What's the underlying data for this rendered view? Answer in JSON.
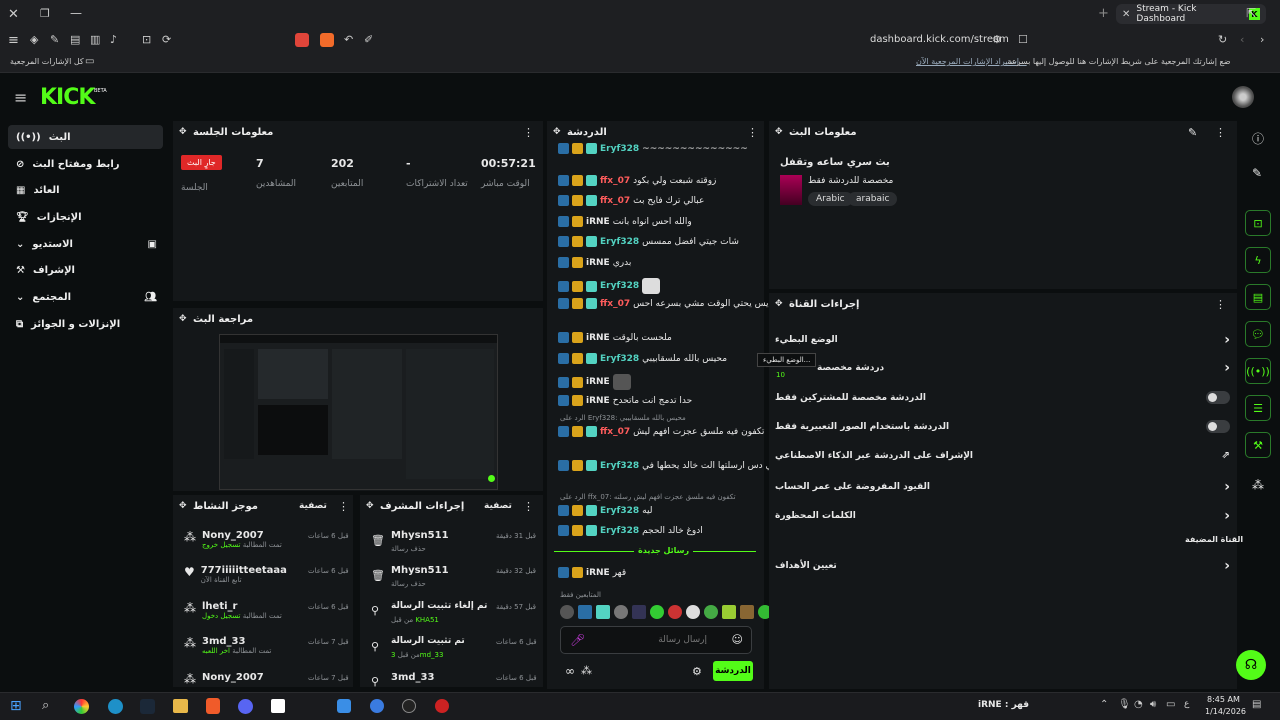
{
  "browser": {
    "tab_title": "Stream - Kick Dashboard",
    "url": "dashboard.kick.com/stream",
    "bookmark_hint": "ضع إشارتك المرجعية على شريط الإشارات هنا للوصول إليها بسرعة.",
    "bookmark_link": "إستيراد الإشارات المرجعية الآن...",
    "all_bookmarks": "كل الإشارات المرجعية"
  },
  "brand": {
    "logo": "KICK",
    "beta": "BETA",
    "accent": "#53fc18"
  },
  "nav": [
    {
      "label": "البث",
      "icon": "live-icon"
    },
    {
      "label": "رابط ومفتاح البث",
      "icon": "link-icon"
    },
    {
      "label": "العائد",
      "icon": "revenue-icon"
    },
    {
      "label": "الإنجازات",
      "icon": "trophy-icon"
    },
    {
      "label": "الاستديو",
      "icon": "studio-icon"
    },
    {
      "label": "الإشراف",
      "icon": "moderation-icon"
    },
    {
      "label": "المجتمع",
      "icon": "community-icon"
    },
    {
      "label": "الإنزالات و الجوائز",
      "icon": "drops-icon"
    }
  ],
  "session": {
    "title": "معلومات الجلسة",
    "live_badge": "جارٍ البث",
    "session_label": "الجلسة",
    "stats": [
      {
        "value": "7",
        "label": "المشاهدين"
      },
      {
        "value": "202",
        "label": "المتابعين"
      },
      {
        "value": "-",
        "label": "تعداد الاشتراكات"
      },
      {
        "value": "00:57:21",
        "label": "الوقت مباشر"
      }
    ]
  },
  "preview": {
    "title": "مراجعة البث"
  },
  "feed": {
    "title": "موجز النشاط",
    "filter": "تصفية",
    "items": [
      {
        "user": "Nony_2007",
        "sub": "تمت المطالبة",
        "action": "تسجيل خروج",
        "time": "قبل 6 ساعات"
      },
      {
        "user": "777iiiiitteetaaa",
        "sub": "تابع القناة الآن",
        "action": "",
        "time": "قبل 6 ساعات"
      },
      {
        "user": "lheti_r",
        "sub": "تمت المطالبة",
        "action": "تسجيل دخول",
        "time": "قبل 6 ساعات"
      },
      {
        "user": "3md_33",
        "sub": "تمت المطالبة",
        "action": "اخر اللعبه",
        "time": "قبل 7 ساعات"
      },
      {
        "user": "Nony_2007",
        "sub": "",
        "action": "",
        "time": "قبل 7 ساعات"
      }
    ]
  },
  "modlog": {
    "title": "إجراءات المشرف",
    "filter": "تصفية",
    "items": [
      {
        "user": "Mhysn511",
        "sub": "حذف رسالة",
        "time": "قبل 31 دقيقة"
      },
      {
        "user": "Mhysn511",
        "sub": "حذف رسالة",
        "time": "قبل 32 دقيقة"
      },
      {
        "user": "تم إلغاء تثبيت الرسالة",
        "sub": "من قبل",
        "by": "KHA51",
        "time": "قبل 57 دقيقة"
      },
      {
        "user": "تم تثبيت الرسالة",
        "sub": "من قبل",
        "by": "3md_33",
        "time": "قبل 6 ساعات"
      },
      {
        "user": "3md_33",
        "sub": "",
        "time": "قبل 6 ساعات"
      }
    ]
  },
  "chat": {
    "title": "الدردشة",
    "new_messages": "رسائل جديدة",
    "followers_only": "المتابعين فقط",
    "placeholder": "إرسال رسالة",
    "send": "الدردشة",
    "messages": [
      {
        "user": "Eryf328",
        "text": "~~~~~~~~~~~~~~",
        "color": "#53d3c2"
      },
      {
        "user": "ffx_07",
        "text": "زوقته شبعت ولي بكود",
        "color": "#ff5c5c"
      },
      {
        "user": "ffx_07",
        "text": "عبالي ترك فايح بث",
        "color": "#ff5c5c"
      },
      {
        "user": "iRNE",
        "text": "والله احس انواه بانت",
        "color": "#ffffff"
      },
      {
        "user": "Eryf328",
        "text": "شات جيتي افضل ممسس",
        "color": "#53d3c2"
      },
      {
        "user": "iRNE",
        "text": "بدري",
        "color": "#ffffff"
      },
      {
        "user": "Eryf328",
        "text": "",
        "color": "#53d3c2"
      },
      {
        "user": "ffx_07",
        "text": "يس يحتي الوقت مشي بسرعه احس",
        "color": "#ff5c5c"
      },
      {
        "user": "iRNE",
        "text": "ملحست بالوقت",
        "color": "#ffffff"
      },
      {
        "user": "Eryf328",
        "text": "محيس بالله ملسقابيبي",
        "color": "#53d3c2"
      },
      {
        "user": "iRNE",
        "text": "",
        "color": "#ffffff"
      },
      {
        "user": "iRNE",
        "text": "حدا تدمج انت ماتحدح",
        "color": "#ffffff"
      },
      {
        "user": "ffx_07",
        "text": "تكفون فيه ملسق عجزت افهم ليش",
        "color": "#ff5c5c"
      },
      {
        "user": "Eryf328",
        "text": "في دس ارسلتها الت خالد يحطها في",
        "color": "#53d3c2"
      },
      {
        "user": "Eryf328",
        "text": "ليه",
        "color": "#53d3c2"
      },
      {
        "user": "Eryf328",
        "text": "ادوغ خالد الحجم",
        "color": "#53d3c2"
      },
      {
        "user": "iRNE",
        "text": "قهر",
        "color": "#ffffff"
      }
    ],
    "reply1": "الرد على Eryf328: محيس بالله ملسقابيبي",
    "reply2": "الرد على ffx_07: تكفون فيه ملسق عجزت افهم ليش رسلته"
  },
  "stream_info": {
    "title": "معلومات البث",
    "stream_title": "بث سري ساعه وتقفل",
    "category": "مخصصة للدردشة فقط",
    "tags": [
      "Arabic",
      "arabaic"
    ]
  },
  "channel_actions": {
    "title": "إجراءات القناة",
    "slow_mode": "الوضع البطيء",
    "slow_tooltip": "الوضع البطيء...",
    "followers_chat": "دردشة مخصصة",
    "followers_value": "10",
    "subs_only": "الدردشة مخصصة للمشتركين فقط",
    "emotes_only": "الدردشة باستخدام الصور التعبيرية فقط",
    "ai_mod": "الإشراف على الدردشة عبر الذكاء الاصطناعي",
    "age_limits": "القيود المفروضة على عمر الحساب",
    "banned_words": "الكلمات المحظورة",
    "promoted_channel": "القناة المضيفة",
    "goals": "تعيين الأهداف"
  },
  "taskbar": {
    "time": "8:45 AM",
    "date": "1/14/2026",
    "notif": "قهر : iRNE"
  }
}
